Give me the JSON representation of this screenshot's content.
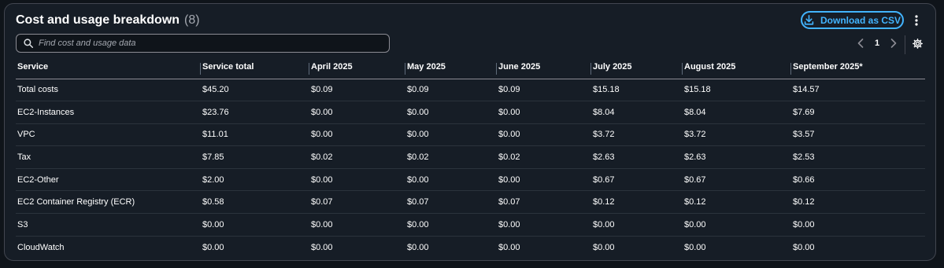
{
  "header": {
    "title": "Cost and usage breakdown",
    "count": "(8)",
    "download_label": "Download as CSV"
  },
  "search": {
    "placeholder": "Find cost and usage data"
  },
  "pagination": {
    "current_page": "1"
  },
  "table": {
    "columns": [
      "Service",
      "Service total",
      "April 2025",
      "May 2025",
      "June 2025",
      "July 2025",
      "August 2025",
      "September 2025*"
    ],
    "rows": [
      [
        "Total costs",
        "$45.20",
        "$0.09",
        "$0.09",
        "$0.09",
        "$15.18",
        "$15.18",
        "$14.57"
      ],
      [
        "EC2-Instances",
        "$23.76",
        "$0.00",
        "$0.00",
        "$0.00",
        "$8.04",
        "$8.04",
        "$7.69"
      ],
      [
        "VPC",
        "$11.01",
        "$0.00",
        "$0.00",
        "$0.00",
        "$3.72",
        "$3.72",
        "$3.57"
      ],
      [
        "Tax",
        "$7.85",
        "$0.02",
        "$0.02",
        "$0.02",
        "$2.63",
        "$2.63",
        "$2.53"
      ],
      [
        "EC2-Other",
        "$2.00",
        "$0.00",
        "$0.00",
        "$0.00",
        "$0.67",
        "$0.67",
        "$0.66"
      ],
      [
        "EC2 Container Registry (ECR)",
        "$0.58",
        "$0.07",
        "$0.07",
        "$0.07",
        "$0.12",
        "$0.12",
        "$0.12"
      ],
      [
        "S3",
        "$0.00",
        "$0.00",
        "$0.00",
        "$0.00",
        "$0.00",
        "$0.00",
        "$0.00"
      ],
      [
        "CloudWatch",
        "$0.00",
        "$0.00",
        "$0.00",
        "$0.00",
        "$0.00",
        "$0.00",
        "$0.00"
      ]
    ]
  },
  "colors": {
    "accent": "#42b4ff",
    "background": "#0f141a",
    "panel": "#161d26"
  },
  "icons": {
    "download": "download-icon",
    "more": "kebab-menu-icon",
    "search": "search-icon",
    "prev": "chevron-left-icon",
    "next": "chevron-right-icon",
    "settings": "gear-icon"
  }
}
